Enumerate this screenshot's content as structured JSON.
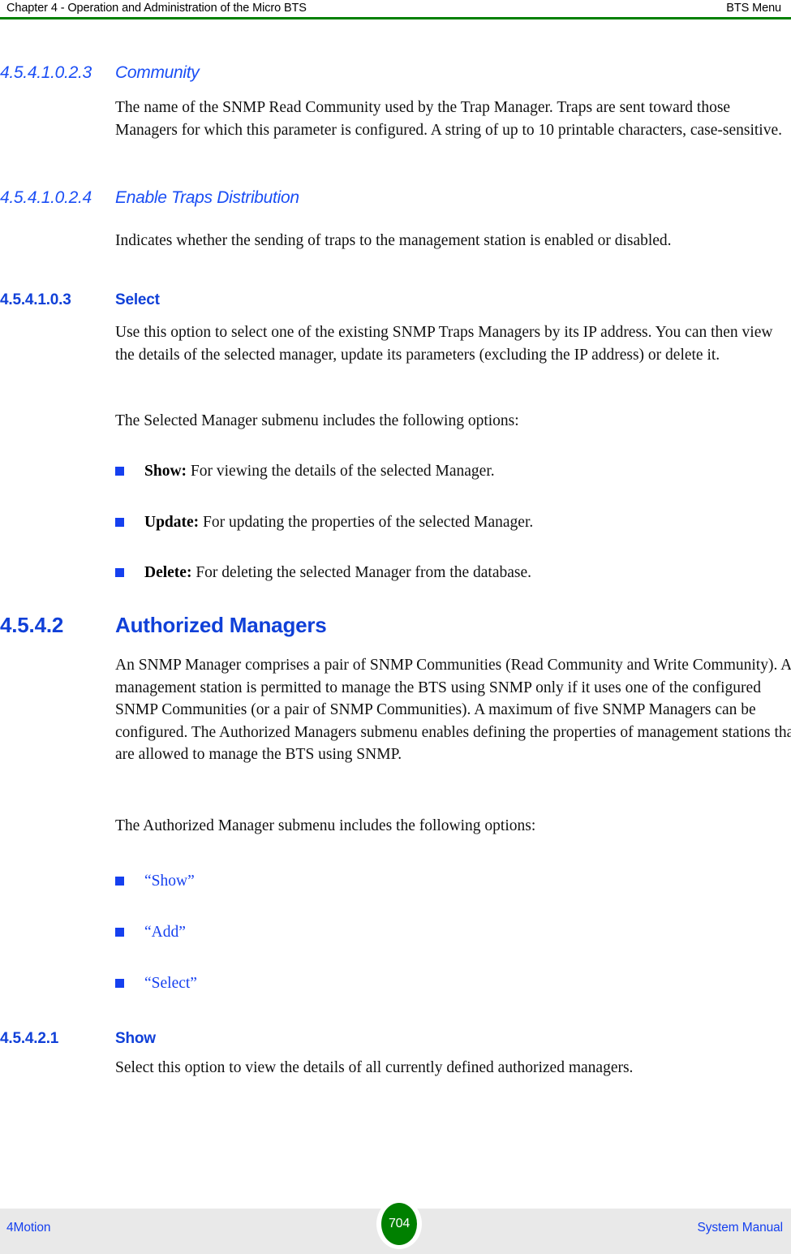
{
  "header": {
    "left": "Chapter 4 - Operation and Administration of the Micro BTS",
    "right": "BTS Menu",
    "rule_color": "#008000"
  },
  "colors": {
    "heading_blue": "#1040d8",
    "italic_heading_blue": "#1a4ef5",
    "bullet_blue": "#1540ef",
    "xref_blue": "#1540ef",
    "footer_band": "#e9e9e9",
    "badge_green": "#008000"
  },
  "sections": [
    {
      "id": "community",
      "number": "4.5.4.1.0.2.3",
      "title": "Community",
      "level": "h7",
      "body": "The name of the SNMP Read Community used by the Trap Manager. Traps are sent toward those Managers for which this parameter is configured. A string of up to 10 printable characters, case-sensitive."
    },
    {
      "id": "enable-traps-distribution",
      "number": "4.5.4.1.0.2.4",
      "title": "Enable Traps Distribution",
      "level": "h7",
      "body": "Indicates whether the sending of traps to the management station is enabled or disabled."
    },
    {
      "id": "select",
      "number": "4.5.4.1.0.3",
      "title": "Select",
      "level": "h6",
      "body": "Use this option to select one of the existing SNMP Traps Managers by its IP address. You can then view the details of the selected manager, update its parameters (excluding the IP address) or delete it.",
      "intro": "The Selected Manager submenu includes the following options:",
      "bullets": [
        {
          "label": "Show:",
          "text": " For viewing the details of the selected Manager."
        },
        {
          "label": "Update:",
          "text": " For updating the properties of the selected Manager."
        },
        {
          "label": "Delete:",
          "text": " For deleting the selected Manager from the database."
        }
      ]
    },
    {
      "id": "authorized-managers",
      "number": "4.5.4.2",
      "title": "Authorized Managers",
      "level": "h4",
      "body": "An SNMP Manager comprises a pair of SNMP Communities (Read Community and Write Community). A management station is permitted to manage the BTS using SNMP only if it uses one of the configured SNMP Communities (or a pair of SNMP Communities). A maximum of five SNMP Managers can be configured. The Authorized Managers submenu enables defining the properties of management stations that are allowed to manage the BTS using SNMP.",
      "intro": "The Authorized Manager submenu includes the following options:",
      "xrefs": [
        "“Show”",
        "“Add”",
        "“Select”"
      ]
    },
    {
      "id": "show",
      "number": "4.5.4.2.1",
      "title": "Show",
      "level": "h5",
      "body": "Select this option to view the details of all currently defined authorized managers."
    }
  ],
  "footer": {
    "left": "4Motion",
    "page_number": "704",
    "right": "System Manual"
  }
}
